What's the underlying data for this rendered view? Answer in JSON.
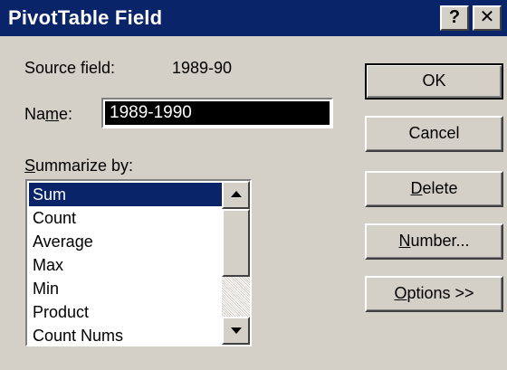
{
  "window": {
    "title": "PivotTable Field",
    "help_glyph": "?",
    "close_glyph": "✕"
  },
  "source_field": {
    "label": "Source field:",
    "value": "1989-90"
  },
  "name_field": {
    "label_prefix": "Na",
    "label_underlined": "m",
    "label_suffix": "e:",
    "value": "1989-1990"
  },
  "summarize": {
    "label_underlined": "S",
    "label_rest": "ummarize by:",
    "items": [
      "Sum",
      "Count",
      "Average",
      "Max",
      "Min",
      "Product",
      "Count Nums"
    ],
    "selected": "Sum"
  },
  "buttons": {
    "ok": "OK",
    "cancel": "Cancel",
    "delete_underlined": "D",
    "delete_rest": "elete",
    "number_underlined": "N",
    "number_rest": "umber...",
    "options_underlined": "O",
    "options_rest": "ptions >>"
  }
}
